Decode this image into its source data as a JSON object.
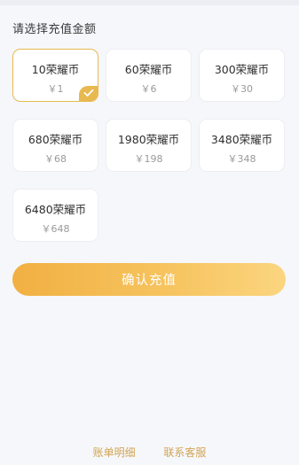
{
  "header": {
    "title": "请选择充值金额"
  },
  "options": [
    {
      "name": "10荣耀币",
      "price": "￥1",
      "selected": true
    },
    {
      "name": "60荣耀币",
      "price": "￥6",
      "selected": false
    },
    {
      "name": "300荣耀币",
      "price": "￥30",
      "selected": false
    },
    {
      "name": "680荣耀币",
      "price": "￥68",
      "selected": false
    },
    {
      "name": "1980荣耀币",
      "price": "￥198",
      "selected": false
    },
    {
      "name": "3480荣耀币",
      "price": "￥348",
      "selected": false
    },
    {
      "name": "6480荣耀币",
      "price": "￥648",
      "selected": false
    }
  ],
  "confirm_button": {
    "label": "确认充值"
  },
  "footer": {
    "bill_details": "账单明细",
    "contact_service": "联系客服"
  },
  "colors": {
    "accent": "#e7b94f",
    "button_start": "#f1b042",
    "button_end": "#fbd57f",
    "link": "#d2a553"
  },
  "icons": {
    "selected_badge": "checkmark-icon"
  }
}
